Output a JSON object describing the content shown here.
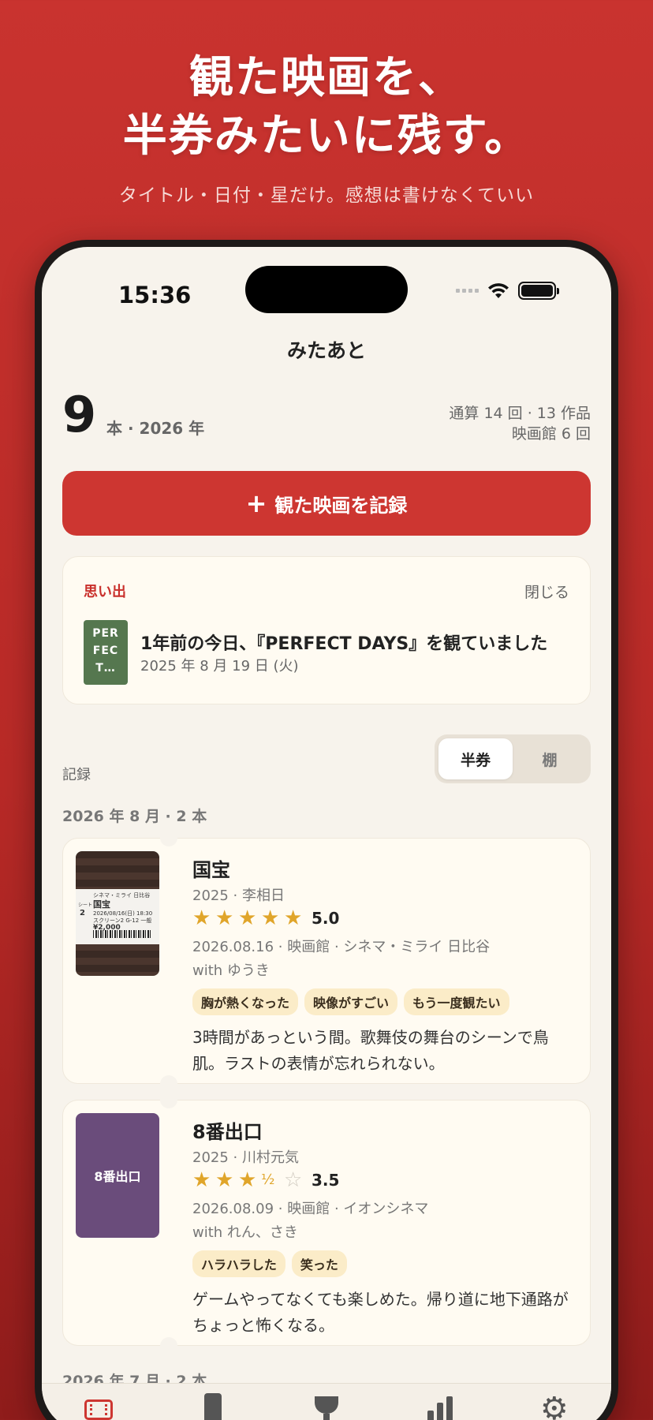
{
  "promo": {
    "headline_line1": "観た映画を、",
    "headline_line2": "半券みたいに残す。",
    "subline": "タイトル・日付・星だけ。感想は書けなくていい"
  },
  "status_bar": {
    "time": "15:36"
  },
  "app": {
    "title": "みたあと"
  },
  "summary": {
    "count": "9",
    "unit": "本 · 2026 年",
    "total_line": "通算 14 回 · 13 作品",
    "theater_line": "映画館 6 回"
  },
  "record_button": {
    "plus": "+",
    "label": "観た映画を記録"
  },
  "memory": {
    "label": "思い出",
    "close": "閉じる",
    "thumb_text": "PER FEC T…",
    "title": "1年前の今日、『PERFECT DAYS』を観ていました",
    "date": "2025 年 8 月 19 日 (火)"
  },
  "records_section": {
    "label": "記録",
    "segments": [
      "半券",
      "棚"
    ],
    "selected": "半券"
  },
  "groups": [
    {
      "header": "2026 年 8 月 · 2 本"
    },
    {
      "header": "2026 年 7 月 · 2 本"
    }
  ],
  "entries": [
    {
      "title": "国宝",
      "meta": "2025 · 李相日",
      "rating": 5.0,
      "score": "5.0",
      "watch": "2026.08.16 · 映画館 · シネマ・ミライ 日比谷",
      "with": "with ゆうき",
      "tags": [
        "胸が熱くなった",
        "映像がすごい",
        "もう一度観たい"
      ],
      "note": "3時間があっという間。歌舞伎の舞台のシーンで鳥肌。ラストの表情が忘れられない。",
      "poster": {
        "theater": "シネマ・ミライ 日比谷",
        "movie": "国宝",
        "date": "2026/08/16(日) 18:30 ",
        "screen": "スクリーン2 G-12 一般",
        "label_seat": "シート",
        "seat_row": "2",
        "price": "¥2,000"
      }
    },
    {
      "title": "8番出口",
      "meta": "2025 · 川村元気",
      "rating": 3.5,
      "score": "3.5",
      "watch": "2026.08.09 · 映画館 · イオンシネマ",
      "with": "with れん、さき",
      "tags": [
        "ハラハラした",
        "笑った"
      ],
      "note": "ゲームやってなくても楽しめた。帰り道に地下通路がちょっと怖くなる。",
      "poster": {
        "label": "8番出口",
        "color": "#6a4c7b"
      }
    }
  ],
  "tab_bar": {
    "items": [
      "ticket-icon",
      "phone-icon",
      "trophy-icon",
      "stats-icon",
      "gear-icon"
    ],
    "active": "ticket-icon"
  },
  "colors": {
    "accent": "#cd3631",
    "background": "#f7f3ec",
    "card": "#fffbf2",
    "star": "#e0a52a",
    "tag": "#fbecc8"
  }
}
